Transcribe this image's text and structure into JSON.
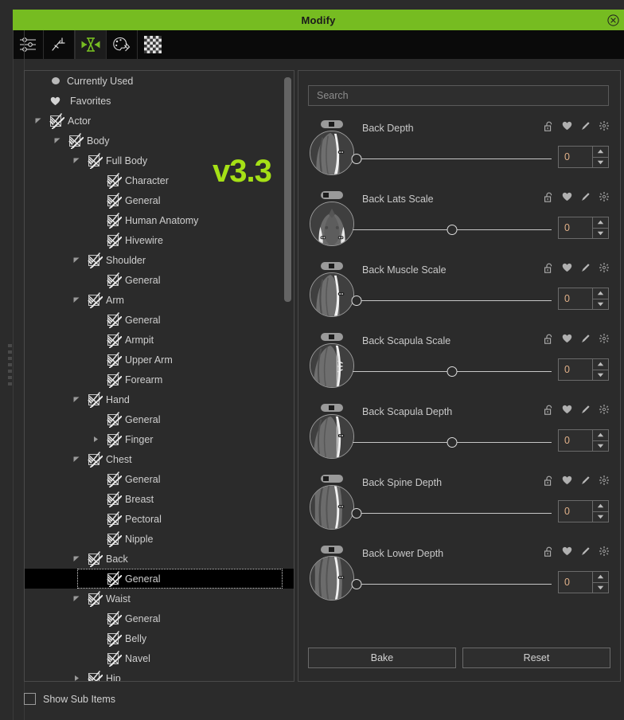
{
  "window": {
    "title": "Modify",
    "close_icon": "close-circle-icon",
    "accent_color": "#76bc21",
    "background_color": "#2b2b2b"
  },
  "toolbar": {
    "items": [
      {
        "name": "sliders-icon",
        "label": "Sliders",
        "active": false
      },
      {
        "name": "pose-icon",
        "label": "Pose",
        "active": false
      },
      {
        "name": "morph-icon",
        "label": "Morph",
        "active": true
      },
      {
        "name": "palette-icon",
        "label": "Material",
        "active": false
      },
      {
        "name": "checker-icon",
        "label": "Texture",
        "active": false
      }
    ]
  },
  "watermark": {
    "text": "v3.3",
    "color": "#a5e016"
  },
  "tree": {
    "items": [
      {
        "label": "Currently Used",
        "depth": 0,
        "icon": "dot-icon",
        "twisty": "none",
        "checkbox": "none",
        "selected": false
      },
      {
        "label": "Favorites",
        "depth": 0,
        "icon": "heart-icon",
        "twisty": "none",
        "checkbox": "none",
        "selected": false
      },
      {
        "label": "Actor",
        "depth": 0,
        "icon": "none",
        "twisty": "expanded",
        "checkbox": "checked",
        "selected": false
      },
      {
        "label": "Body",
        "depth": 1,
        "icon": "none",
        "twisty": "expanded",
        "checkbox": "checked",
        "selected": false
      },
      {
        "label": "Full Body",
        "depth": 2,
        "icon": "none",
        "twisty": "expanded",
        "checkbox": "checked",
        "selected": false
      },
      {
        "label": "Character",
        "depth": 3,
        "icon": "none",
        "twisty": "none",
        "checkbox": "checked",
        "selected": false
      },
      {
        "label": "General",
        "depth": 3,
        "icon": "none",
        "twisty": "none",
        "checkbox": "checked",
        "selected": false
      },
      {
        "label": "Human Anatomy",
        "depth": 3,
        "icon": "none",
        "twisty": "none",
        "checkbox": "checked",
        "selected": false
      },
      {
        "label": "Hivewire",
        "depth": 3,
        "icon": "none",
        "twisty": "none",
        "checkbox": "checked",
        "selected": false
      },
      {
        "label": "Shoulder",
        "depth": 2,
        "icon": "none",
        "twisty": "expanded",
        "checkbox": "checked",
        "selected": false
      },
      {
        "label": "General",
        "depth": 3,
        "icon": "none",
        "twisty": "none",
        "checkbox": "checked",
        "selected": false
      },
      {
        "label": "Arm",
        "depth": 2,
        "icon": "none",
        "twisty": "expanded",
        "checkbox": "checked",
        "selected": false
      },
      {
        "label": "General",
        "depth": 3,
        "icon": "none",
        "twisty": "none",
        "checkbox": "checked",
        "selected": false
      },
      {
        "label": "Armpit",
        "depth": 3,
        "icon": "none",
        "twisty": "none",
        "checkbox": "checked",
        "selected": false
      },
      {
        "label": "Upper Arm",
        "depth": 3,
        "icon": "none",
        "twisty": "none",
        "checkbox": "checked",
        "selected": false
      },
      {
        "label": "Forearm",
        "depth": 3,
        "icon": "none",
        "twisty": "none",
        "checkbox": "checked",
        "selected": false
      },
      {
        "label": "Hand",
        "depth": 2,
        "icon": "none",
        "twisty": "expanded",
        "checkbox": "checked",
        "selected": false
      },
      {
        "label": "General",
        "depth": 3,
        "icon": "none",
        "twisty": "none",
        "checkbox": "checked",
        "selected": false
      },
      {
        "label": "Finger",
        "depth": 3,
        "icon": "none",
        "twisty": "collapsed",
        "checkbox": "checked",
        "selected": false
      },
      {
        "label": "Chest",
        "depth": 2,
        "icon": "none",
        "twisty": "expanded",
        "checkbox": "checked",
        "selected": false
      },
      {
        "label": "General",
        "depth": 3,
        "icon": "none",
        "twisty": "none",
        "checkbox": "checked",
        "selected": false
      },
      {
        "label": "Breast",
        "depth": 3,
        "icon": "none",
        "twisty": "none",
        "checkbox": "checked",
        "selected": false
      },
      {
        "label": "Pectoral",
        "depth": 3,
        "icon": "none",
        "twisty": "none",
        "checkbox": "checked",
        "selected": false
      },
      {
        "label": "Nipple",
        "depth": 3,
        "icon": "none",
        "twisty": "none",
        "checkbox": "checked",
        "selected": false
      },
      {
        "label": "Back",
        "depth": 2,
        "icon": "none",
        "twisty": "expanded",
        "checkbox": "checked",
        "selected": false
      },
      {
        "label": "General",
        "depth": 3,
        "icon": "none",
        "twisty": "none",
        "checkbox": "checked",
        "selected": true
      },
      {
        "label": "Waist",
        "depth": 2,
        "icon": "none",
        "twisty": "expanded",
        "checkbox": "checked",
        "selected": false
      },
      {
        "label": "General",
        "depth": 3,
        "icon": "none",
        "twisty": "none",
        "checkbox": "checked",
        "selected": false
      },
      {
        "label": "Belly",
        "depth": 3,
        "icon": "none",
        "twisty": "none",
        "checkbox": "checked",
        "selected": false
      },
      {
        "label": "Navel",
        "depth": 3,
        "icon": "none",
        "twisty": "none",
        "checkbox": "checked",
        "selected": false
      },
      {
        "label": "Hip",
        "depth": 2,
        "icon": "none",
        "twisty": "collapsed",
        "checkbox": "checked",
        "selected": false
      }
    ]
  },
  "show_sub_items": {
    "label": "Show Sub Items",
    "checked": false
  },
  "search": {
    "placeholder": "Search",
    "value": ""
  },
  "sliders": {
    "row_icons": [
      "lock-open-icon",
      "heart-icon",
      "pencil-icon",
      "gear-icon"
    ],
    "items": [
      {
        "name": "Back Depth",
        "value": "0",
        "handle_pct": 2,
        "pill": "mid",
        "thumb": "back-depth-thumb"
      },
      {
        "name": "Back Lats Scale",
        "value": "0",
        "handle_pct": 50,
        "pill": "left",
        "thumb": "back-lats-thumb"
      },
      {
        "name": "Back Muscle Scale",
        "value": "0",
        "handle_pct": 2,
        "pill": "mid",
        "thumb": "back-muscle-thumb"
      },
      {
        "name": "Back Scapula  Scale",
        "value": "0",
        "handle_pct": 50,
        "pill": "mid",
        "thumb": "back-scapula-scale-thumb"
      },
      {
        "name": "Back Scapula Depth",
        "value": "0",
        "handle_pct": 50,
        "pill": "mid",
        "thumb": "back-scapula-depth-thumb"
      },
      {
        "name": "Back Spine Depth",
        "value": "0",
        "handle_pct": 2,
        "pill": "left",
        "thumb": "back-spine-thumb"
      },
      {
        "name": "Back Lower Depth",
        "value": "0",
        "handle_pct": 2,
        "pill": "mid",
        "thumb": "back-lower-thumb"
      }
    ]
  },
  "footer": {
    "bake_label": "Bake",
    "reset_label": "Reset"
  }
}
